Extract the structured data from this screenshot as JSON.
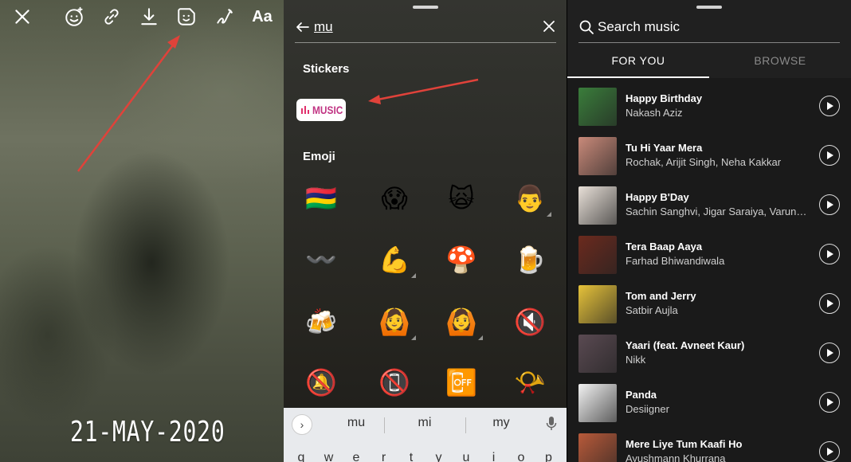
{
  "editor": {
    "tools": [
      {
        "name": "close-icon"
      },
      {
        "name": "face-effects-icon"
      },
      {
        "name": "link-icon"
      },
      {
        "name": "download-icon"
      },
      {
        "name": "sticker-icon"
      },
      {
        "name": "draw-icon"
      },
      {
        "name": "text-tool"
      }
    ],
    "text_tool_label": "Aa",
    "date_text": "21-MAY-2020",
    "annotation_color": "#e0423a"
  },
  "sticker_search": {
    "query": "mu",
    "stickers_heading": "Stickers",
    "music_sticker_label": "MUSIC",
    "emoji_heading": "Emoji",
    "emojis": [
      "🇲🇺",
      "😱",
      "🙀",
      "👨",
      "〰️",
      "💪",
      "🍄",
      "🍺",
      "🍻",
      "🙆",
      "🙆",
      "🔇",
      "🔕",
      "📵",
      "📴",
      "📯"
    ],
    "keyboard": {
      "suggestions": [
        "mu",
        "mi",
        "my"
      ],
      "keys": [
        "q",
        "w",
        "e",
        "r",
        "t",
        "y",
        "u",
        "i",
        "o",
        "p"
      ]
    }
  },
  "music": {
    "search_placeholder": "Search music",
    "tabs": [
      {
        "label": "FOR YOU",
        "active": true
      },
      {
        "label": "BROWSE",
        "active": false
      }
    ],
    "songs": [
      {
        "title": "Happy Birthday",
        "artist": "Nakash Aziz",
        "cover_color": "#3a7d3b"
      },
      {
        "title": "Tu Hi Yaar Mera",
        "artist": "Rochak, Arijit Singh, Neha Kakkar",
        "cover_color": "#c98a7a"
      },
      {
        "title": "Happy B'Day",
        "artist": "Sachin Sanghvi, Jigar Saraiya, Varun D…",
        "cover_color": "#e8e0d8"
      },
      {
        "title": "Tera Baap Aaya",
        "artist": "Farhad Bhiwandiwala",
        "cover_color": "#6b2a1e"
      },
      {
        "title": "Tom and Jerry",
        "artist": "Satbir Aujla",
        "cover_color": "#e6c23a"
      },
      {
        "title": "Yaari (feat. Avneet Kaur)",
        "artist": "Nikk",
        "cover_color": "#5a4a52"
      },
      {
        "title": "Panda",
        "artist": "Desiigner",
        "cover_color": "#f2f2f2"
      },
      {
        "title": "Mere Liye Tum Kaafi Ho",
        "artist": "Ayushmann Khurrana",
        "cover_color": "#b85a3a"
      }
    ]
  }
}
